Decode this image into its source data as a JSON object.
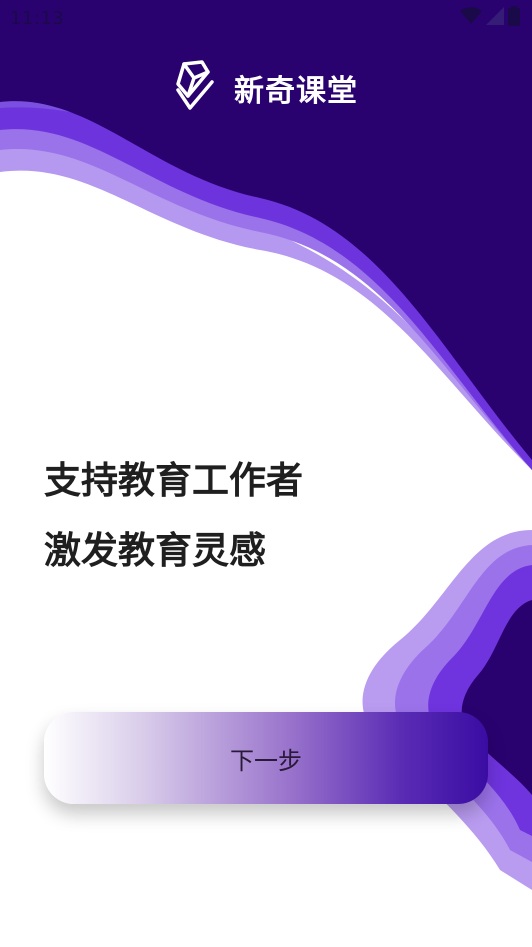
{
  "status_bar": {
    "time": "11:13",
    "icons": [
      "wifi-icon",
      "signal-icon",
      "battery-icon"
    ]
  },
  "header": {
    "app_name": "新奇课堂",
    "logo_icon": "book-stack-logo-icon"
  },
  "headline": {
    "line1": "支持教育工作者",
    "line2": "激发教育灵感"
  },
  "next_button": {
    "label": "下一步"
  },
  "colors": {
    "primary_dark": "#2a0270",
    "wave_mid": "#6a2ee0",
    "wave_light": "#a98ae8",
    "text_dark": "#1f1f1f"
  }
}
